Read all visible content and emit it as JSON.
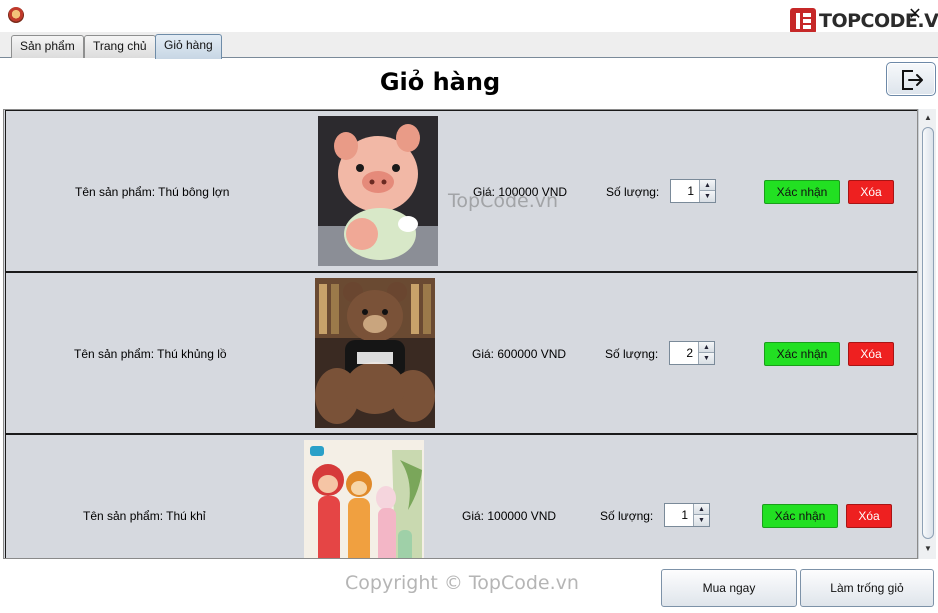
{
  "window": {
    "brand_text": "TOPCODE.VN",
    "close_symbol": "✕"
  },
  "tabs": [
    {
      "label": "Sản phẩm",
      "active": false
    },
    {
      "label": "Trang chủ",
      "active": false
    },
    {
      "label": "Giỏ hàng",
      "active": true
    }
  ],
  "page": {
    "title": "Giỏ hàng",
    "logout_icon": "logout-icon"
  },
  "cart": {
    "items": [
      {
        "name": "Tên sản phẩm: Thú bông lợn",
        "price": "Giá: 100000 VND",
        "qty_label": "Số lượng:",
        "qty": "1",
        "confirm": "Xác nhận",
        "delete": "Xóa"
      },
      {
        "name": "Tên sản phẩm: Thú khủng lồ",
        "price": "Giá: 600000 VND",
        "qty_label": "Số lượng:",
        "qty": "2",
        "confirm": "Xác nhận",
        "delete": "Xóa"
      },
      {
        "name": "Tên sản phẩm: Thú khỉ",
        "price": "Giá: 100000 VND",
        "qty_label": "Số lượng:",
        "qty": "1",
        "confirm": "Xác nhận",
        "delete": "Xóa"
      }
    ]
  },
  "actions": {
    "buy_now": "Mua ngay",
    "clear_cart": "Làm trống giỏ"
  },
  "watermarks": {
    "center": "TopCode.vn",
    "footer": "Copyright © TopCode.vn"
  },
  "colors": {
    "confirm_green": "#22e022",
    "delete_red": "#ee2020",
    "row_bg": "#d6d9df"
  }
}
